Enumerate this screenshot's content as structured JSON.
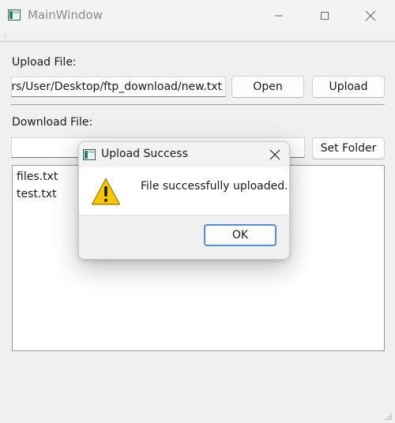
{
  "window": {
    "title": "MainWindow",
    "icon": "app-window-icon"
  },
  "upload": {
    "label": "Upload File:",
    "path_value": "C:/Users/User/Desktop/ftp_download/new.txt",
    "open_label": "Open",
    "upload_label": "Upload"
  },
  "download": {
    "label": "Download File:",
    "path_value": "",
    "set_folder_label": "Set Folder"
  },
  "file_list": {
    "items": [
      "files.txt",
      "test.txt"
    ]
  },
  "dialog": {
    "title": "Upload Success",
    "message": "File successfully uploaded.",
    "ok_label": "OK",
    "icon": "warning-icon"
  },
  "colors": {
    "accent": "#4f8fd6",
    "warning_yellow": "#f7c600"
  }
}
